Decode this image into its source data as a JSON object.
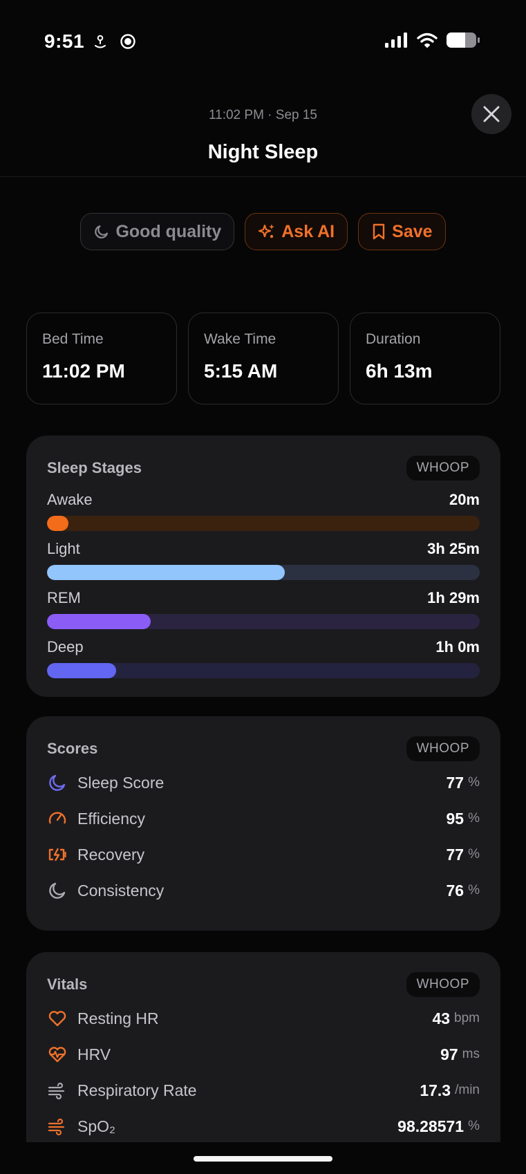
{
  "status_bar": {
    "time": "9:51"
  },
  "header": {
    "subtitle": "11:02 PM · Sep 15",
    "title": "Night Sleep"
  },
  "chips": {
    "quality": "Good quality",
    "ask_ai": "Ask AI",
    "save": "Save"
  },
  "stats": [
    {
      "label": "Bed Time",
      "value": "11:02 PM"
    },
    {
      "label": "Wake Time",
      "value": "5:15 AM"
    },
    {
      "label": "Duration",
      "value": "6h 13m"
    }
  ],
  "sleep_stages": {
    "title": "Sleep Stages",
    "source": "WHOOP",
    "stages": [
      {
        "label": "Awake",
        "value": "20m",
        "fraction": 0.05,
        "color": "#f26c1a",
        "track": "#3a220f"
      },
      {
        "label": "Light",
        "value": "3h 25m",
        "fraction": 0.55,
        "color": "#93c5fd",
        "track": "#2b3140"
      },
      {
        "label": "REM",
        "value": "1h 29m",
        "fraction": 0.24,
        "color": "#8b5cf6",
        "track": "#2a2440"
      },
      {
        "label": "Deep",
        "value": "1h 0m",
        "fraction": 0.16,
        "color": "#6366f1",
        "track": "#24233f"
      }
    ]
  },
  "scores": {
    "title": "Scores",
    "source": "WHOOP",
    "items": [
      {
        "icon": "moon-icon",
        "label": "Sleep Score",
        "value": "77",
        "unit": "%"
      },
      {
        "icon": "gauge-icon",
        "label": "Efficiency",
        "value": "95",
        "unit": "%"
      },
      {
        "icon": "battery-charging-icon",
        "label": "Recovery",
        "value": "77",
        "unit": "%"
      },
      {
        "icon": "moon-outline-icon",
        "label": "Consistency",
        "value": "76",
        "unit": "%"
      }
    ]
  },
  "vitals": {
    "title": "Vitals",
    "source": "WHOOP",
    "items": [
      {
        "icon": "heart-icon",
        "label": "Resting HR",
        "value": "43",
        "unit": "bpm"
      },
      {
        "icon": "heart-pulse-icon",
        "label": "HRV",
        "value": "97",
        "unit": "ms"
      },
      {
        "icon": "wind-icon",
        "label": "Respiratory Rate",
        "value": "17.3",
        "unit": "/min"
      },
      {
        "icon": "wind-orange-icon",
        "label": "SpO₂",
        "value": "98.28571",
        "unit": "%"
      }
    ]
  },
  "colors": {
    "accent": "#f0712a",
    "purple": "#6f6cf0"
  }
}
